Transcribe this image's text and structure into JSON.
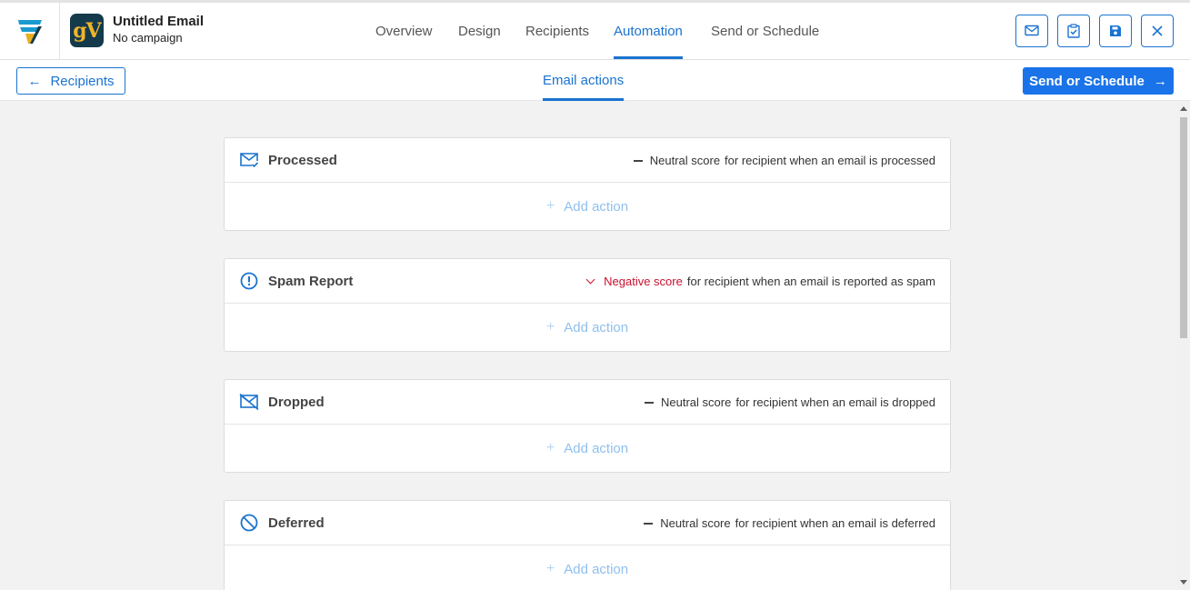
{
  "header": {
    "email_title": "Untitled Email",
    "campaign": "No campaign",
    "app_initials": "gV",
    "tabs": [
      {
        "label": "Overview"
      },
      {
        "label": "Design"
      },
      {
        "label": "Recipients"
      },
      {
        "label": "Automation",
        "active": true
      },
      {
        "label": "Send or Schedule"
      }
    ],
    "icons": [
      "mail-check-icon",
      "clipboard-check-icon",
      "save-icon",
      "close-icon"
    ]
  },
  "subbar": {
    "back_label": "Recipients",
    "back_arrow": "←",
    "center_tab": "Email actions",
    "send_label": "Send or Schedule",
    "send_arrow": "→"
  },
  "cards": [
    {
      "title": "Processed",
      "icon": "mail-check-icon",
      "score_label": "Neutral score",
      "score_type": "neutral",
      "score_desc": "for recipient when an email is processed",
      "add_label": "Add action"
    },
    {
      "title": "Spam Report",
      "icon": "alert-circle-icon",
      "score_label": "Negative score",
      "score_type": "negative",
      "score_desc": "for recipient when an email is reported as spam",
      "add_label": "Add action"
    },
    {
      "title": "Dropped",
      "icon": "mail-off-icon",
      "score_label": "Neutral score",
      "score_type": "neutral",
      "score_desc": "for recipient when an email is dropped",
      "add_label": "Add action"
    },
    {
      "title": "Deferred",
      "icon": "block-icon",
      "score_label": "Neutral score",
      "score_type": "neutral",
      "score_desc": "for recipient when an email is deferred",
      "add_label": "Add action"
    }
  ],
  "colors": {
    "accent": "#1a73d0",
    "primary_button": "#1a73e8",
    "negative": "#c8102e",
    "add_action": "#8fc0ee"
  }
}
